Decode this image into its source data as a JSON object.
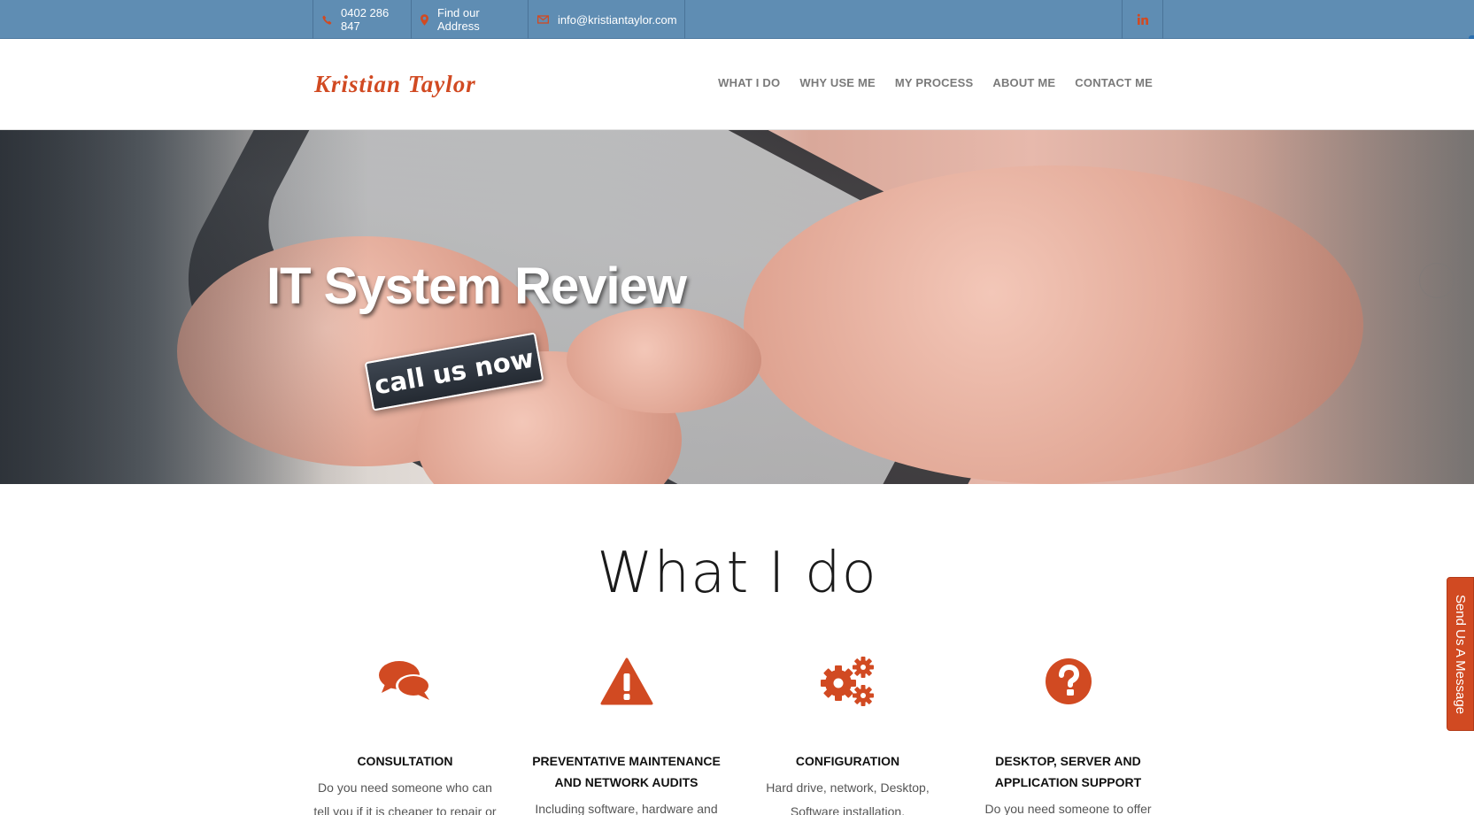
{
  "topbar": {
    "phone": "0402 286 847",
    "address_link": "Find our Address",
    "email": "info@kristiantaylor.com",
    "icons": {
      "phone": "phone-icon",
      "address": "map-marker-icon",
      "email": "envelope-icon",
      "social": "linkedin-icon"
    },
    "background_color": "#5f8db3",
    "icon_color": "#d14a22"
  },
  "header": {
    "logo_text": "Kristian Taylor",
    "nav": [
      {
        "label": "WHAT I DO"
      },
      {
        "label": "WHY USE ME"
      },
      {
        "label": "MY PROCESS"
      },
      {
        "label": "ABOUT ME"
      },
      {
        "label": "CONTACT ME"
      }
    ]
  },
  "hero": {
    "title": "IT System Review",
    "cta_label": "call us now"
  },
  "what_i_do": {
    "title": "What I do",
    "accent_color": "#d14a22",
    "services": [
      {
        "icon": "comments-icon",
        "title": "CONSULTATION",
        "text": "Do you need someone who can tell you if it is cheaper to repair or"
      },
      {
        "icon": "warning-icon",
        "title": "PREVENTATIVE MAINTENANCE AND NETWORK AUDITS",
        "text": "Including software, hardware and"
      },
      {
        "icon": "cogs-icon",
        "title": "CONFIGURATION",
        "text": "Hard drive, network, Desktop, Software installation."
      },
      {
        "icon": "question-circle-icon",
        "title": "DESKTOP, SERVER AND APPLICATION SUPPORT",
        "text": "Do you need someone to offer"
      }
    ]
  },
  "feedback_tab": {
    "label": "Send Us A Message"
  }
}
